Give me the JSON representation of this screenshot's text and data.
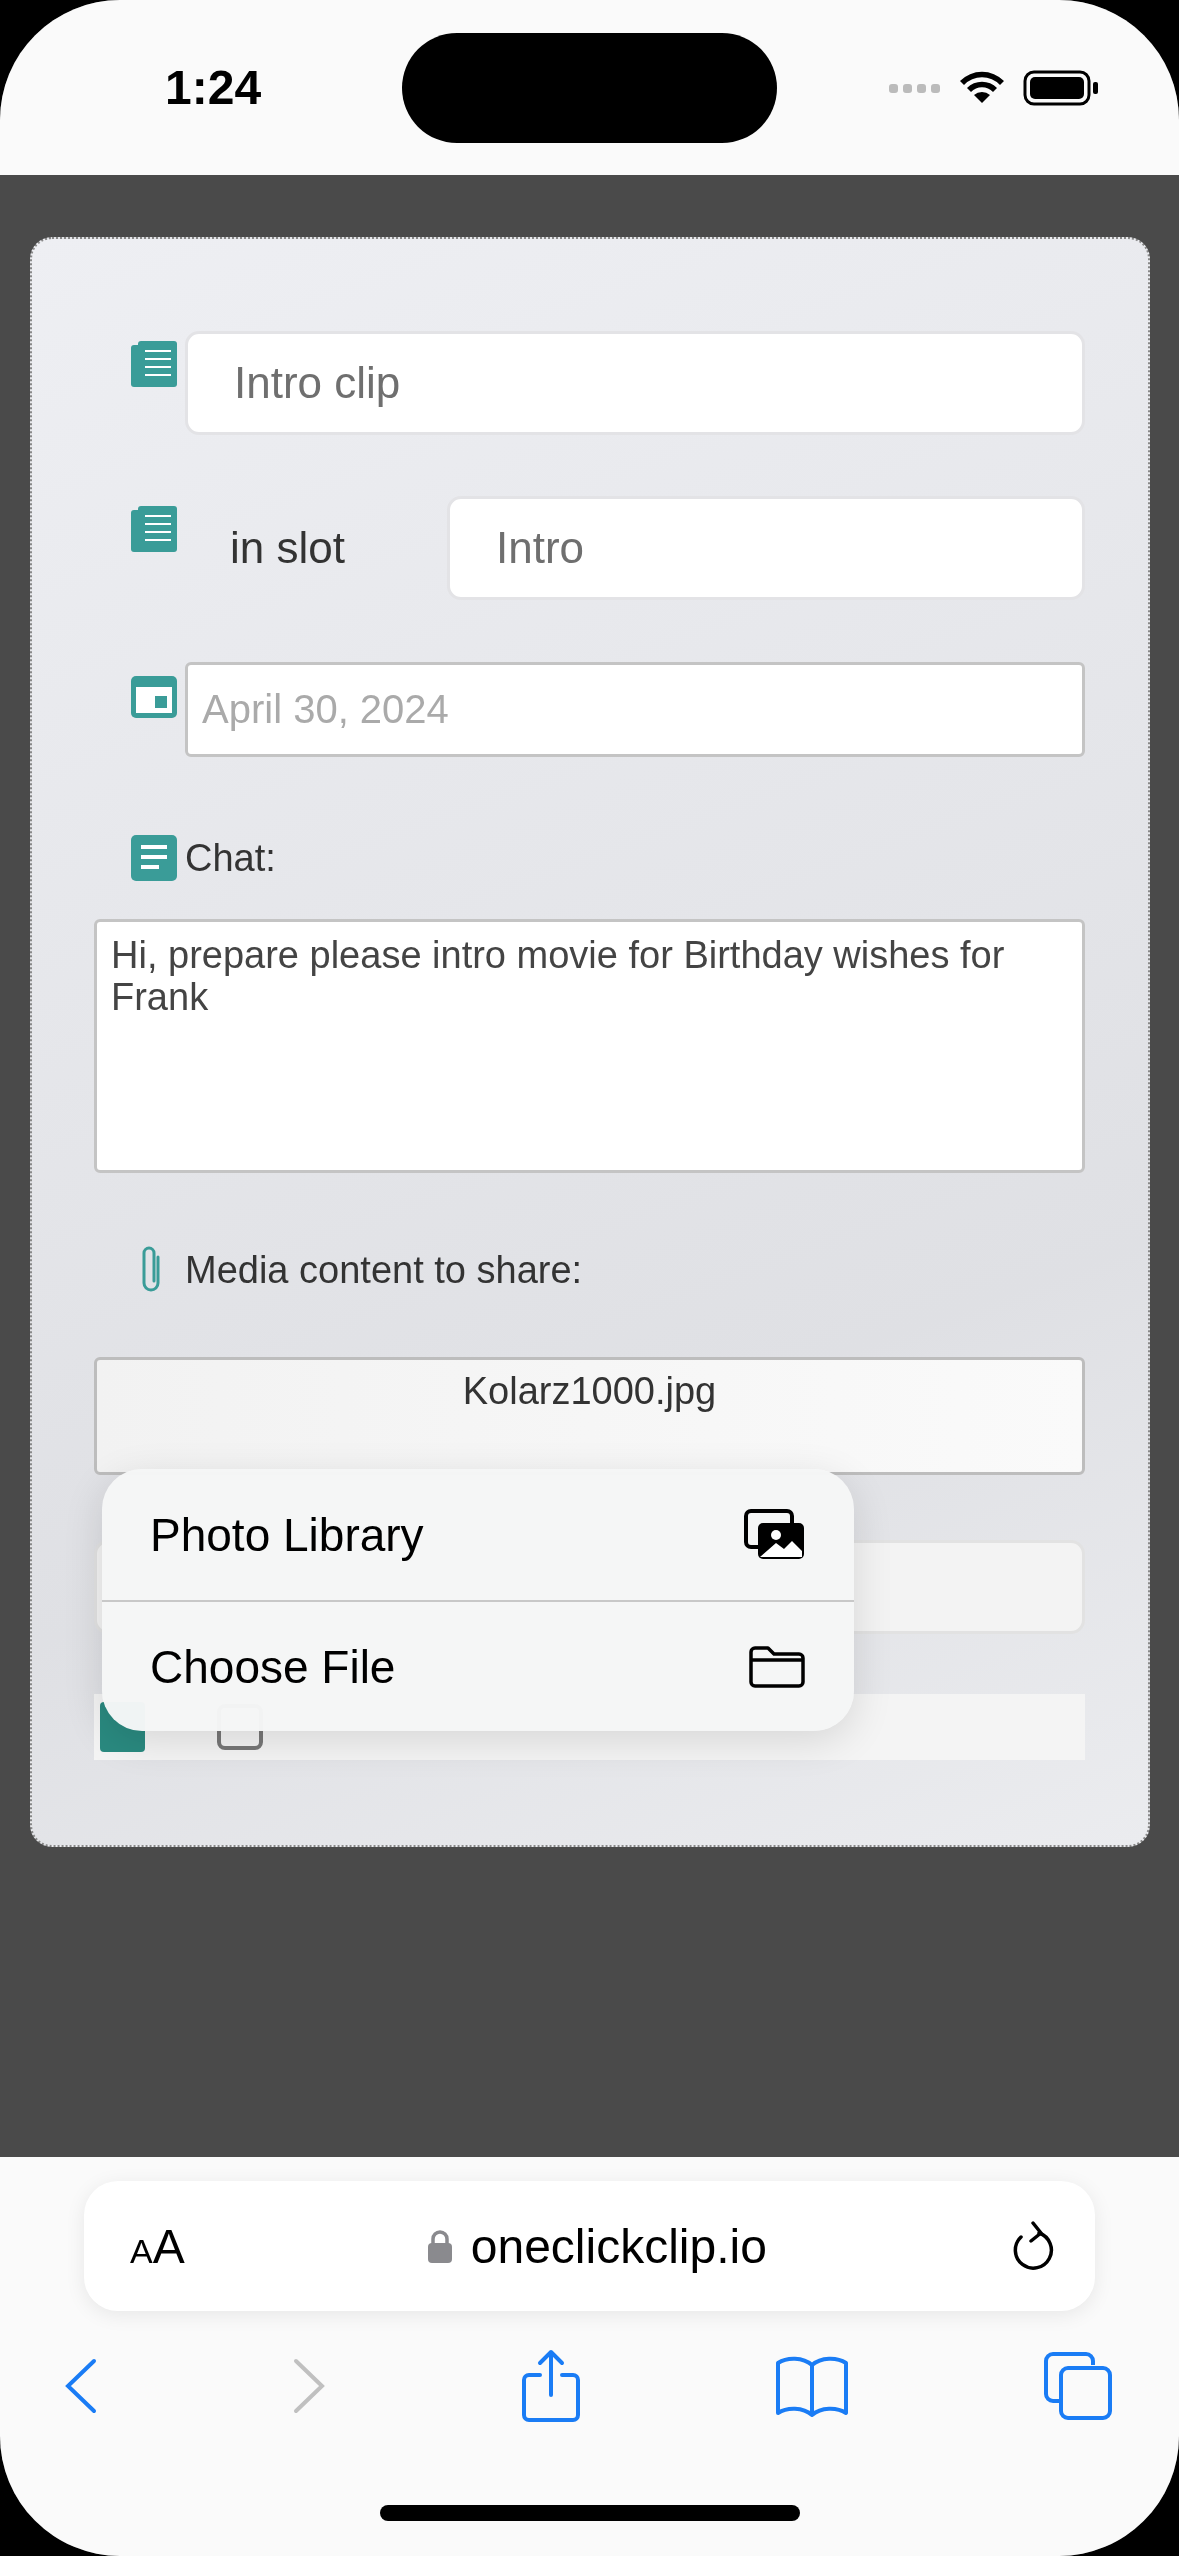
{
  "status_bar": {
    "time": "1:24"
  },
  "form": {
    "title_field": {
      "value": "Intro clip"
    },
    "slot_field": {
      "label": "in slot",
      "value": "Intro"
    },
    "date_field": {
      "placeholder": "April 30, 2024"
    },
    "chat": {
      "label": "Chat:",
      "value": "Hi, prepare please intro movie for Birthday wishes for Frank"
    },
    "media": {
      "label": "Media content to share:",
      "file_name": "Kolarz1000.jpg"
    },
    "task": {
      "checked": false
    }
  },
  "menu": {
    "items": [
      {
        "label": "Photo Library",
        "kind": "photos"
      },
      {
        "label": "Choose File",
        "kind": "folder"
      }
    ]
  },
  "browser": {
    "text_size": {
      "small": "A",
      "large": "A"
    },
    "url": "oneclickclip.io",
    "back_disabled": false,
    "forward_disabled": true
  }
}
